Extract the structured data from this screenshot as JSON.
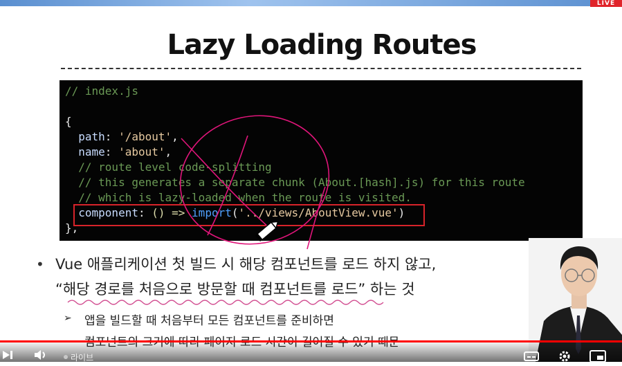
{
  "badge": {
    "live": "LIVE"
  },
  "slide": {
    "title": "Lazy Loading Routes",
    "code": {
      "line1": "// index.js",
      "line2": "{",
      "path_key": "path",
      "path_val": "'/about'",
      "name_key": "name",
      "name_val": "'about'",
      "comment1": "// route level code-splitting",
      "comment2": "// this generates a separate chunk (About.[hash].js) for this route",
      "comment3": "// which is lazy-loaded when the route is visited.",
      "component_key": "component",
      "component_arrow": "() =>",
      "component_import": "import",
      "component_arg": "'../views/AboutView.vue'",
      "close": "},"
    },
    "bullet": {
      "marker": "•",
      "line1": "Vue 애플리케이션 첫 빌드 시 해당 컴포넌트를 로드 하지 않고,",
      "line2": "“해당 경로를 처음으로 방문할 때 컴포넌트를 로드” 하는 것"
    },
    "sub_bullet": {
      "marker": "➢",
      "line1": "앱을 빌드할 때 처음부터 모든 컴포넌트를 준비하면",
      "line2": "컴포넌트의 크기에 따라 페이지 로드 시간이 길어질 수 있기 때문"
    }
  },
  "player": {
    "live_label": "라이브",
    "progress": 1.0,
    "progress_color": "#ff0000",
    "icons": [
      "skip-next-icon",
      "volume-icon",
      "subtitles-icon",
      "settings-icon",
      "miniplayer-icon"
    ]
  },
  "colors": {
    "highlight": "#d8232a",
    "pen": "#e0157a",
    "wavy": "#d14b8f"
  }
}
